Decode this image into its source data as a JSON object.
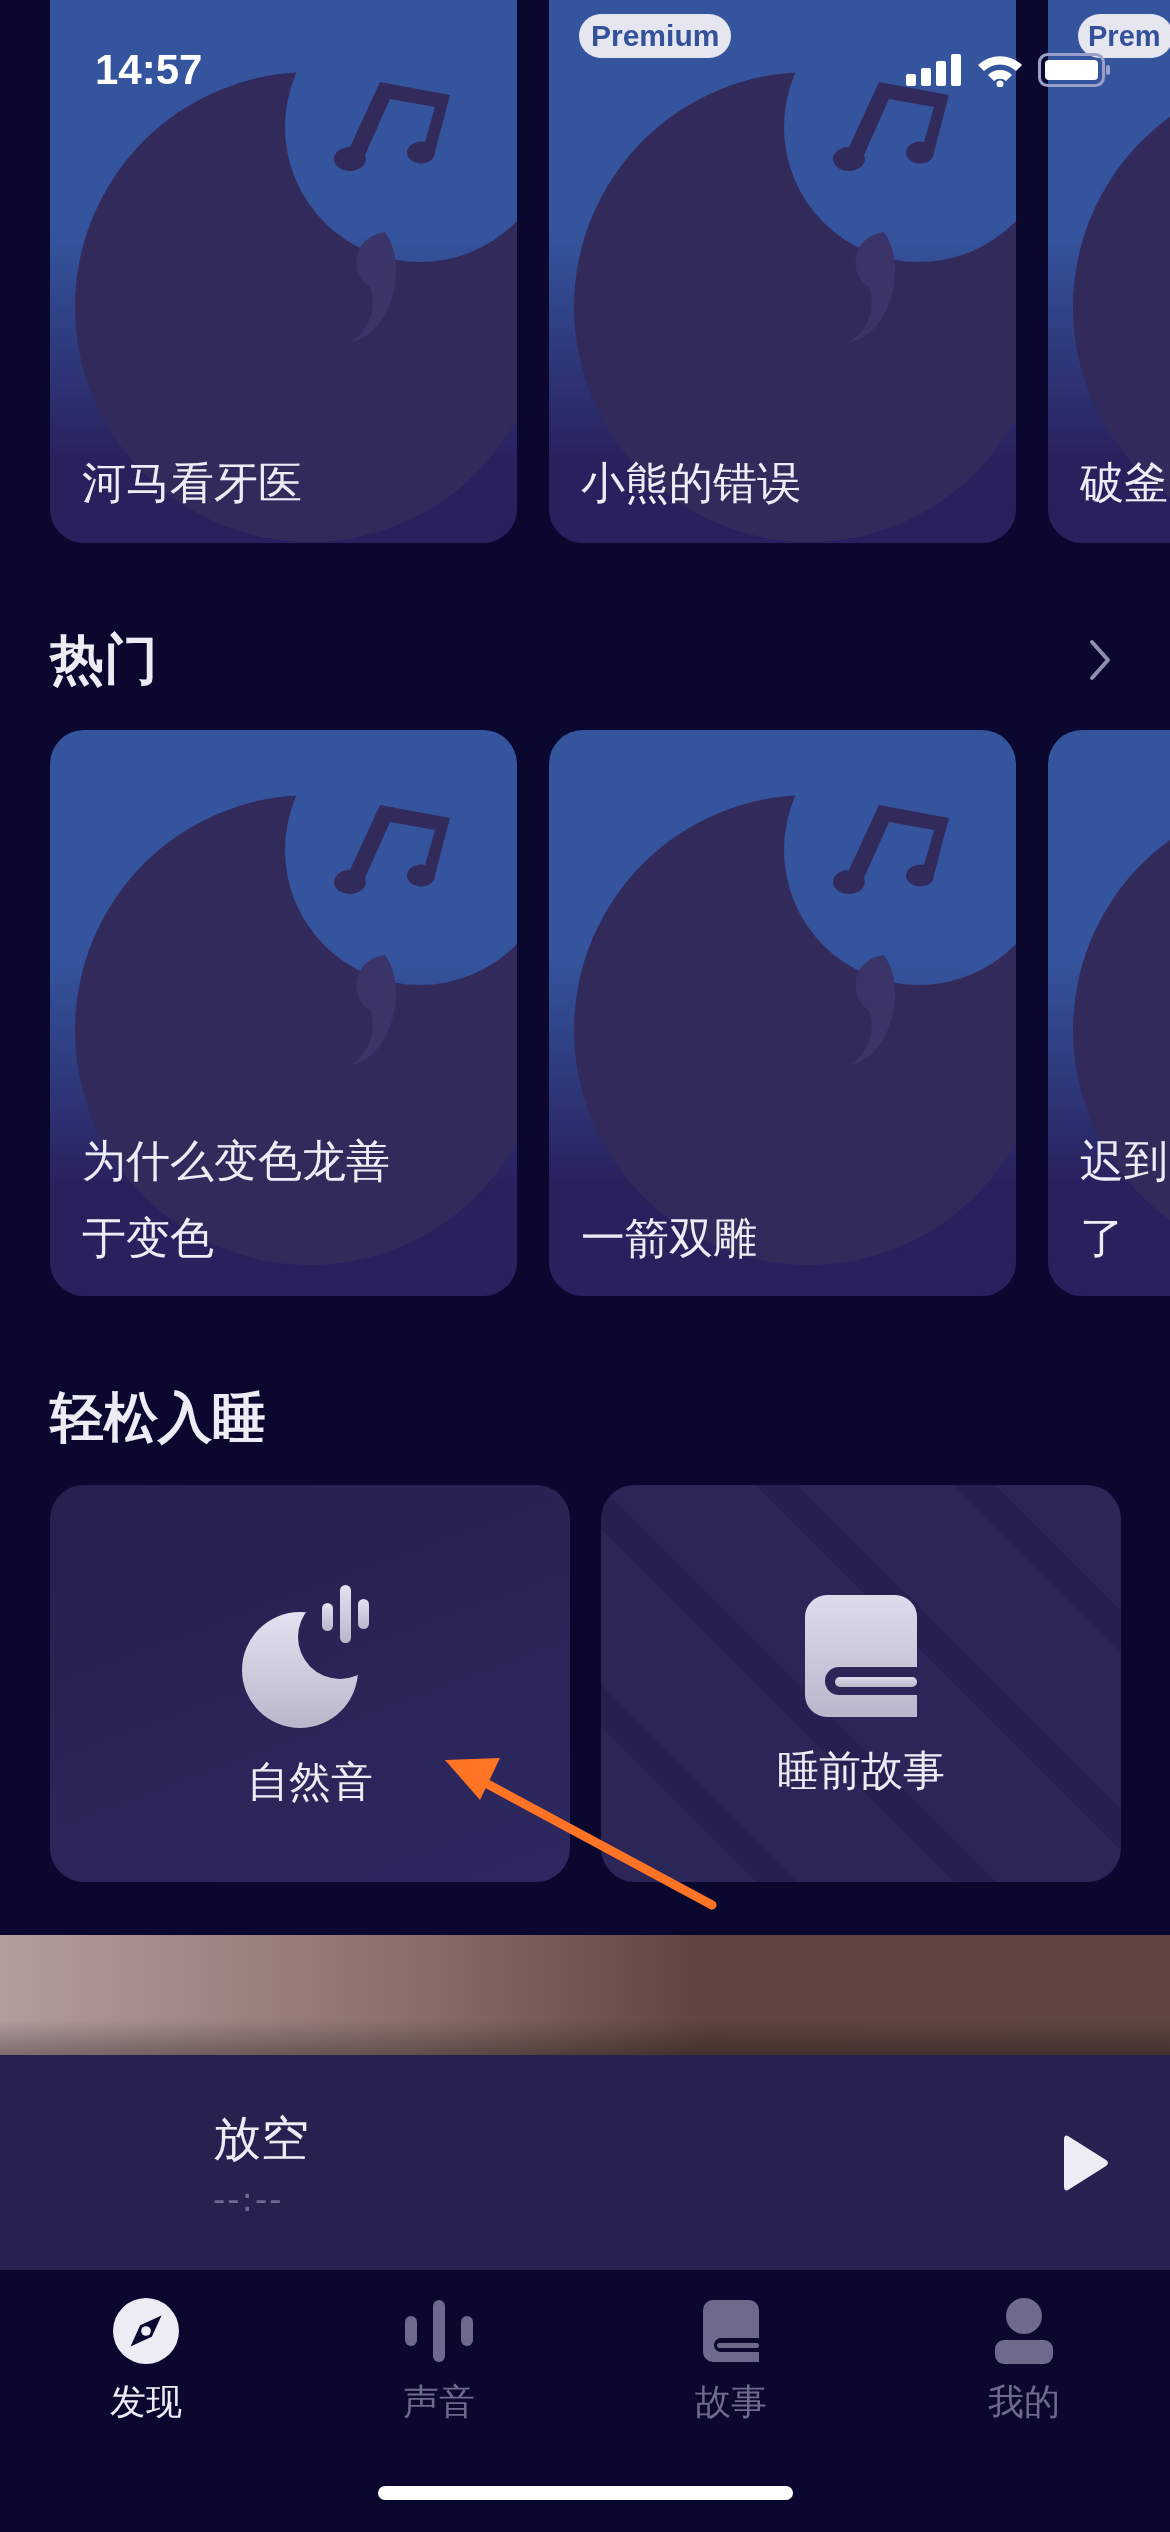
{
  "status_bar": {
    "time": "14:57"
  },
  "top_cards": [
    {
      "title": "河马看牙医"
    },
    {
      "title": "小熊的错误",
      "badge": "Premium"
    },
    {
      "title": "破釜",
      "badge": "Prem"
    }
  ],
  "hot": {
    "title": "热门",
    "cards": [
      {
        "lines": [
          "为什么变色龙善",
          "于变色"
        ]
      },
      {
        "lines": [
          "一箭双雕"
        ]
      },
      {
        "lines": [
          "迟到",
          "了"
        ]
      }
    ]
  },
  "sleep": {
    "title": "轻松入睡",
    "cards": [
      {
        "kind": "nature",
        "label": "自然音"
      },
      {
        "kind": "story",
        "label": "睡前故事"
      }
    ]
  },
  "player": {
    "title": "放空",
    "time": "--:--"
  },
  "tabs": [
    {
      "kind": "compass",
      "label": "发现",
      "selected": true
    },
    {
      "kind": "sound",
      "label": "声音",
      "selected": false
    },
    {
      "kind": "book",
      "label": "故事",
      "selected": false
    },
    {
      "kind": "person",
      "label": "我的",
      "selected": false
    }
  ]
}
